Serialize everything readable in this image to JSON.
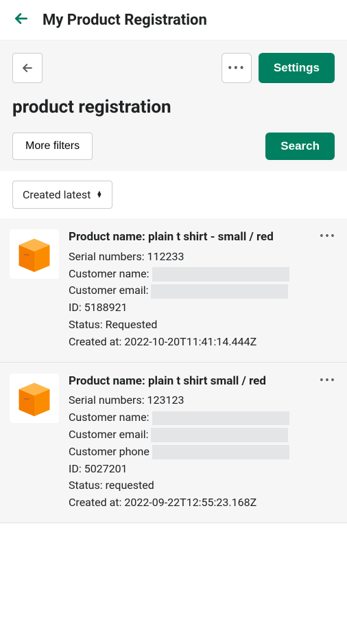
{
  "header": {
    "title": "My Product Registration"
  },
  "toolbar": {
    "settings": "Settings",
    "page_title": "product registration",
    "more_filters": "More filters",
    "search": "Search",
    "sort": "Created latest"
  },
  "items": [
    {
      "product_name": "Product name: plain t shirt - small / red",
      "serial": "Serial numbers: 112233",
      "customer_name_label": "Customer name:",
      "customer_email_label": "Customer email:",
      "id": "ID: 5188921",
      "status": "Status: Requested",
      "created": "Created at: 2022-10-20T11:41:14.444Z"
    },
    {
      "product_name": "Product name: plain t shirt small / red",
      "serial": "Serial numbers: 123123",
      "customer_name_label": "Customer name:",
      "customer_email_label": "Customer email:",
      "customer_phone_label": "Customer phone",
      "id": "ID: 5027201",
      "status": "Status: requested",
      "created": "Created at: 2022-09-22T12:55:23.168Z"
    }
  ]
}
